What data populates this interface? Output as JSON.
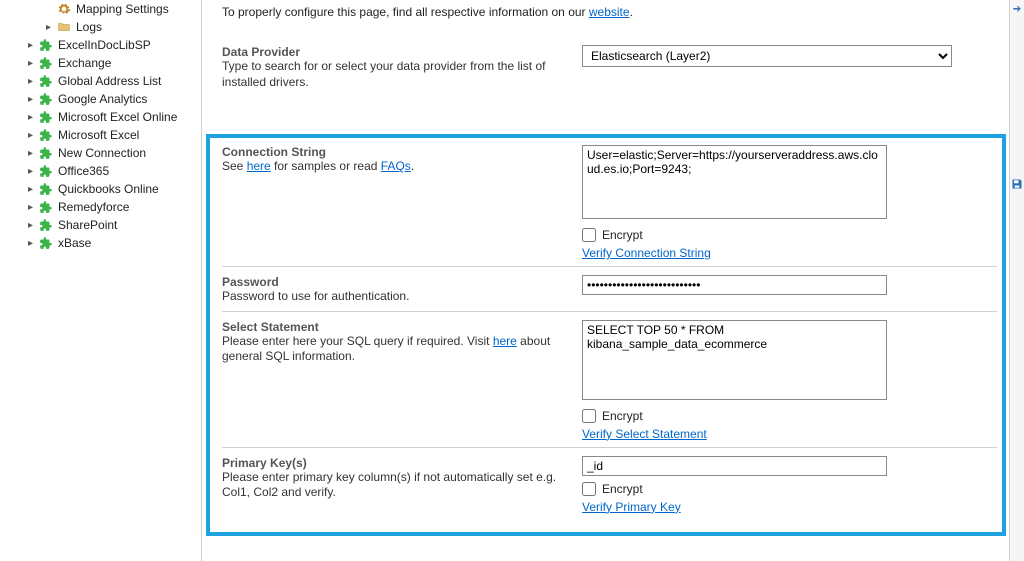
{
  "sidebar": {
    "top_items": [
      {
        "label": "Mapping Settings",
        "indent": "subsub",
        "caret": false,
        "icon": "gear"
      },
      {
        "label": "Logs",
        "indent": "subsub",
        "caret": "right",
        "icon": "folder"
      }
    ],
    "conn_items": [
      {
        "label": "ExcelInDocLibSP"
      },
      {
        "label": "Exchange"
      },
      {
        "label": "Global Address List"
      },
      {
        "label": "Google Analytics"
      },
      {
        "label": "Microsoft Excel Online"
      },
      {
        "label": "Microsoft Excel"
      },
      {
        "label": "New Connection"
      },
      {
        "label": "Office365"
      },
      {
        "label": "Quickbooks Online"
      },
      {
        "label": "Remedyforce"
      },
      {
        "label": "SharePoint"
      },
      {
        "label": "xBase"
      }
    ]
  },
  "intro": {
    "prefix": "To properly configure this page, find all respective information on our ",
    "link": "website",
    "suffix": "."
  },
  "data_provider": {
    "title": "Data Provider",
    "desc": "Type to search for or select your data provider from the list of installed drivers.",
    "value": "Elasticsearch (Layer2)"
  },
  "conn_string": {
    "title": "Connection String",
    "desc_prefix": "See ",
    "here": "here",
    "desc_mid": " for samples or read ",
    "faqs": "FAQs",
    "desc_suffix": ".",
    "value": "User=elastic;Server=https://yourserveraddress.aws.cloud.es.io;Port=9243;",
    "encrypt": "Encrypt",
    "verify": "Verify Connection String"
  },
  "password": {
    "title": "Password",
    "desc": "Password to use for authentication.",
    "value": "•••••••••••••••••••••••••••"
  },
  "select_stmt": {
    "title": "Select Statement",
    "desc_prefix": "Please enter here your SQL query if required. Visit ",
    "here": "here",
    "desc_suffix": " about general SQL information.",
    "value": "SELECT TOP 50 * FROM kibana_sample_data_ecommerce",
    "encrypt": "Encrypt",
    "verify": "Verify Select Statement"
  },
  "primary_key": {
    "title": "Primary Key(s)",
    "desc": "Please enter primary key column(s) if not automatically set e.g. Col1, Col2 and verify.",
    "value": "_id",
    "encrypt": "Encrypt",
    "verify": "Verify Primary Key"
  }
}
